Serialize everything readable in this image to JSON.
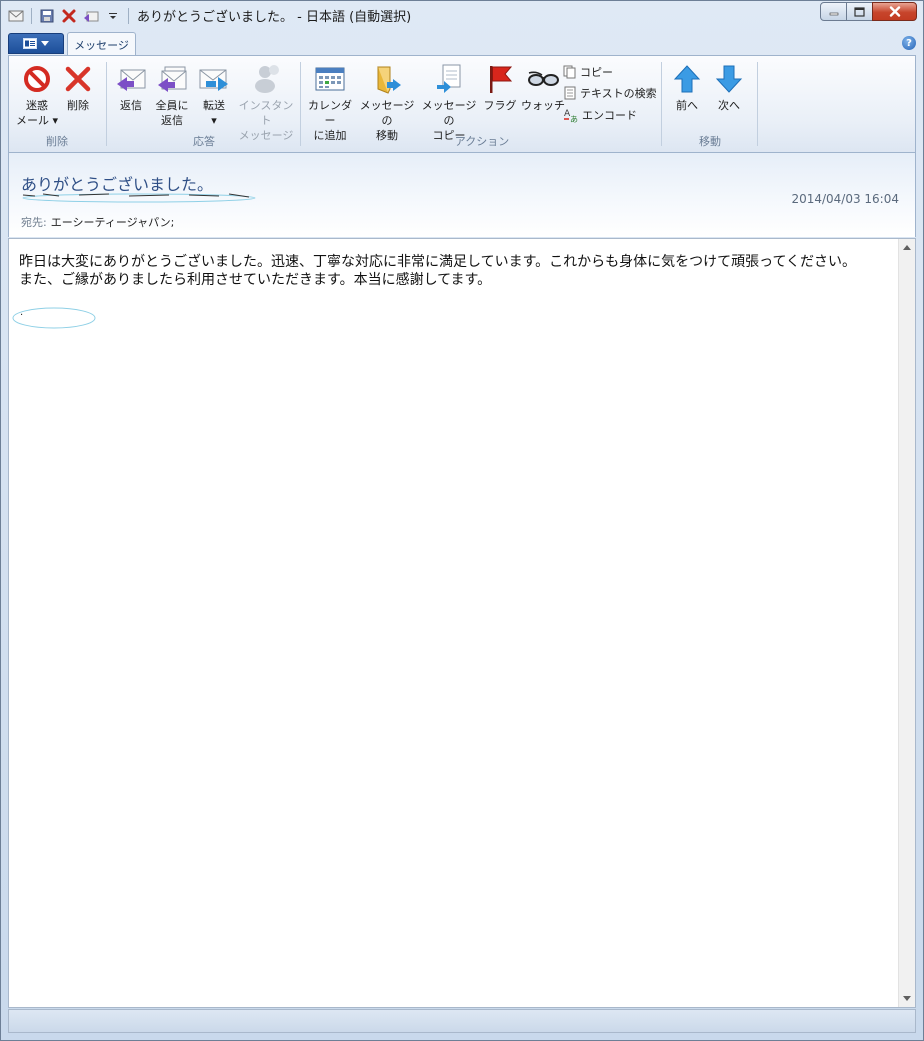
{
  "window": {
    "title": "ありがとうございました。 - 日本語 (自動選択)"
  },
  "tabs": {
    "active": "メッセージ"
  },
  "ribbon": {
    "groups": {
      "delete": {
        "label": "削除",
        "junk_line1": "迷惑",
        "junk_line2": "メール",
        "delete": "削除"
      },
      "respond": {
        "label": "応答",
        "reply": "返信",
        "reply_all_line1": "全員に",
        "reply_all_line2": "返信",
        "forward": "転送",
        "im_line1": "インスタント",
        "im_line2": "メッセージ"
      },
      "actions": {
        "label": "アクション",
        "calendar_line1": "カレンダー",
        "calendar_line2": "に追加",
        "move_line1": "メッセージの",
        "move_line2": "移動",
        "copy_line1": "メッセージの",
        "copy_line2": "コピー",
        "flag": "フラグ",
        "watch": "ウォッチ",
        "copy": "コピー",
        "find": "テキストの検索",
        "encode": "エンコード"
      },
      "navigate": {
        "label": "移動",
        "prev": "前へ",
        "next": "次へ"
      }
    }
  },
  "message": {
    "subject": "ありがとうございました。",
    "date": "2014/04/03 16:04",
    "to_label": "宛先:",
    "to_value": "エーシーティージャパン;",
    "body_line1": "昨日は大変にありがとうございました。迅速、丁寧な対応に非常に満足しています。これからも身体に気をつけて頑張ってください。",
    "body_line2": "また、ご縁がありましたら利用させていただきます。本当に感謝してます。",
    "sig_mark": "."
  },
  "colors": {
    "accent": "#2f4f86",
    "app_menu": "#1d4f9a",
    "close_button": "#c7452c"
  }
}
